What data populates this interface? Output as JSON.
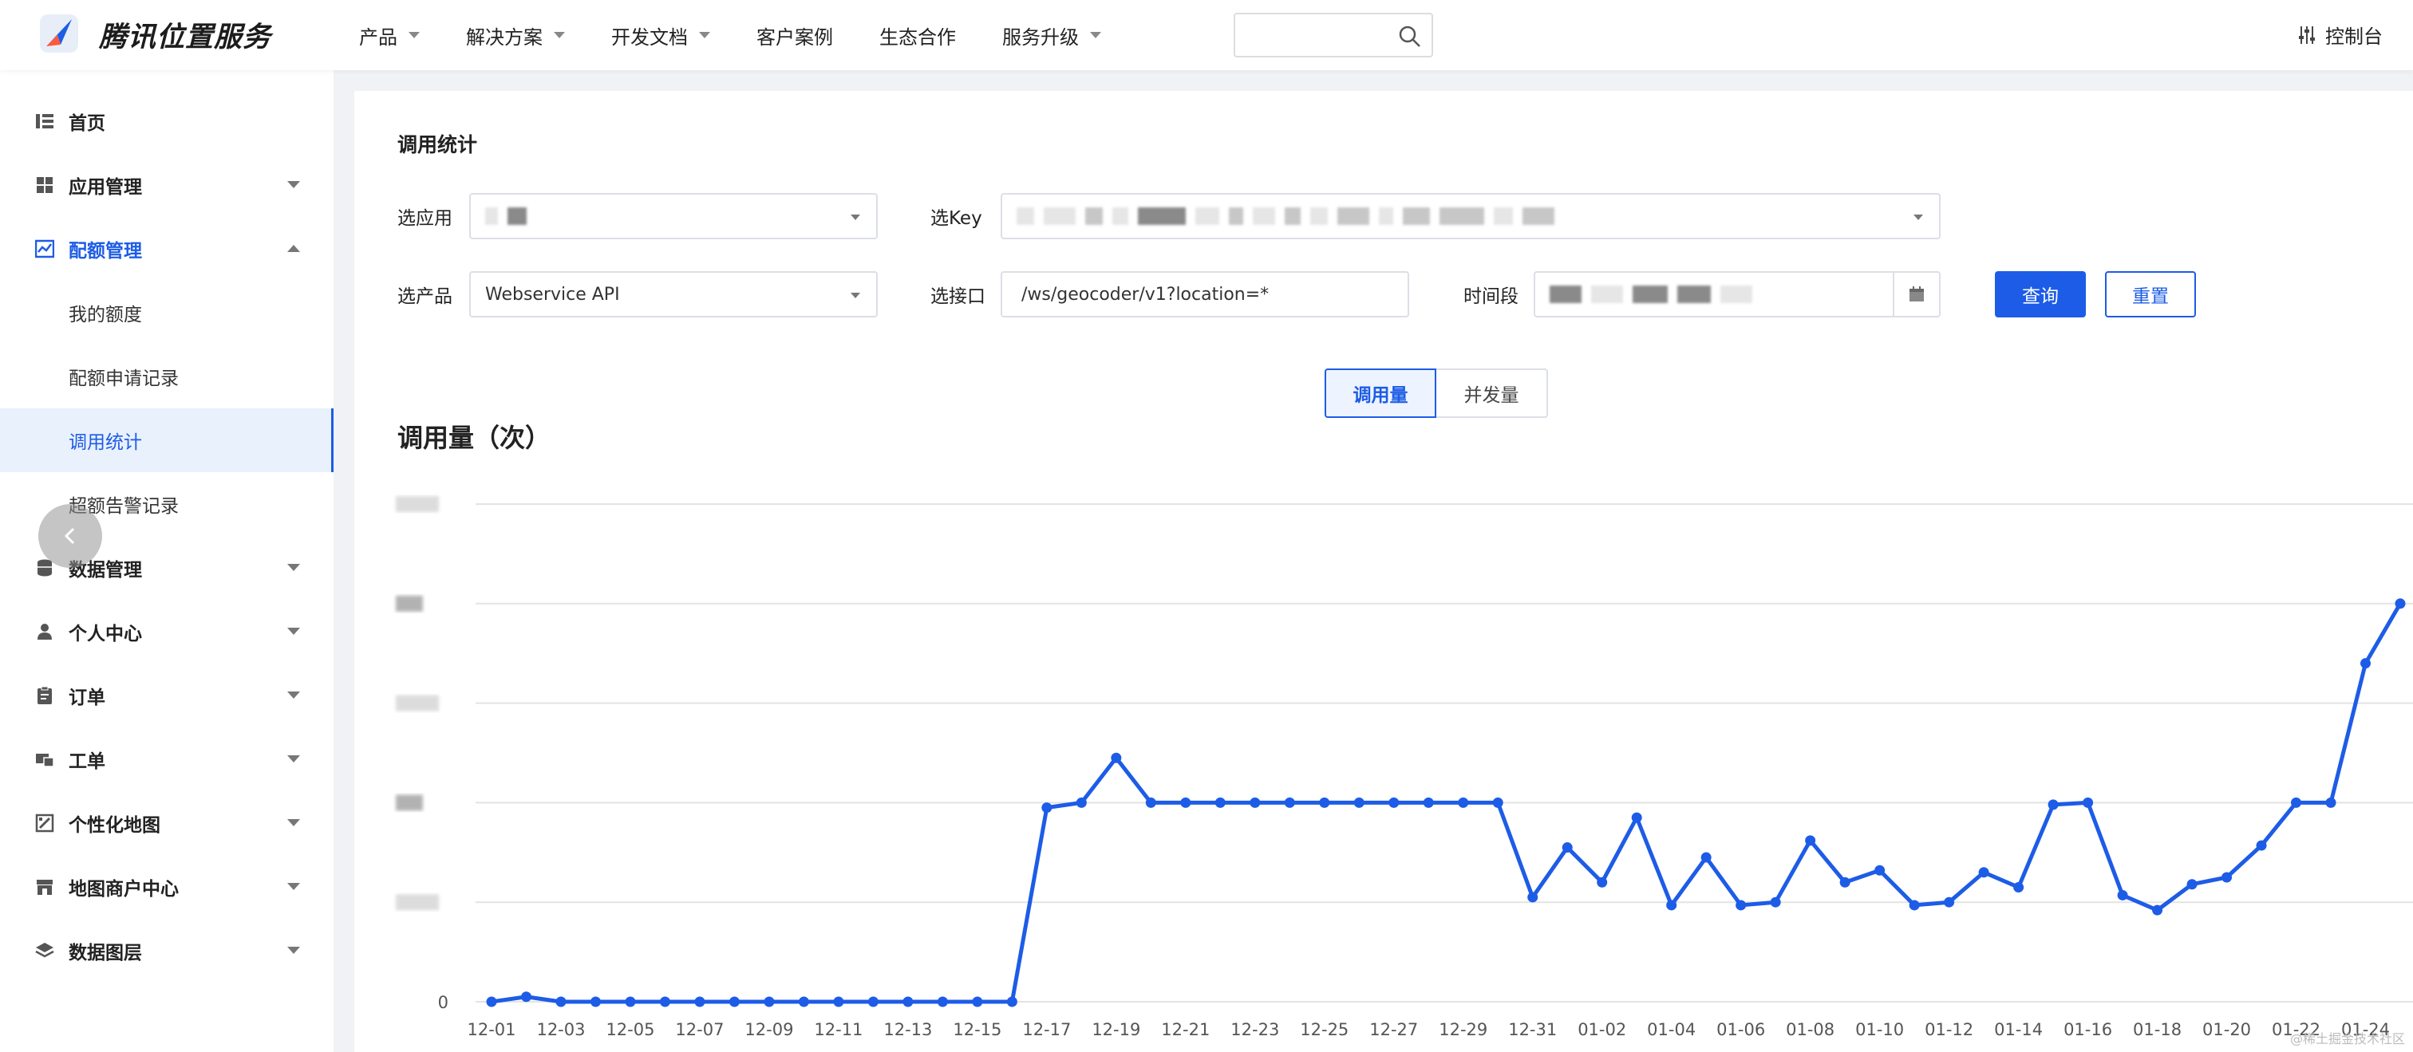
{
  "header": {
    "brand": "腾讯位置服务",
    "nav": [
      "产品",
      "解决方案",
      "开发文档",
      "客户案例",
      "生态合作",
      "服务升级"
    ],
    "nav_has_caret": [
      true,
      true,
      true,
      false,
      false,
      true
    ],
    "search_placeholder": "",
    "console": "控制台"
  },
  "sidebar": {
    "home": "首页",
    "app_manage": "应用管理",
    "quota_manage": "配额管理",
    "quota_sub": [
      "我的额度",
      "配额申请记录",
      "调用统计",
      "超额告警记录"
    ],
    "data_manage": "数据管理",
    "personal": "个人中心",
    "orders": "订单",
    "tickets": "工单",
    "custom_map": "个性化地图",
    "merchant": "地图商户中心",
    "data_layers": "数据图层"
  },
  "main": {
    "title": "调用统计",
    "label_app": "选应用",
    "label_key": "选Key",
    "label_product": "选产品",
    "product_value": "Webservice API",
    "label_api": "选接口",
    "api_value": "/ws/geocoder/v1?location=*",
    "label_time": "时间段",
    "btn_query": "查询",
    "btn_reset": "重置",
    "tab_calls": "调用量",
    "tab_concurrency": "并发量",
    "chart_title": "调用量（次）"
  },
  "watermark": "@稀土掘金技术社区",
  "chart_data": {
    "type": "line",
    "title": "调用量（次）",
    "xlabel": "",
    "ylabel": "",
    "y_tick_labels_visible": [
      "0"
    ],
    "y_levels": 5,
    "color": "#1d5ce6",
    "x_tick_labels": [
      "12-01",
      "12-03",
      "12-05",
      "12-07",
      "12-09",
      "12-11",
      "12-13",
      "12-15",
      "12-17",
      "12-19",
      "12-21",
      "12-23",
      "12-25",
      "12-27",
      "12-29",
      "12-31",
      "01-02",
      "01-04",
      "01-06",
      "01-08",
      "01-10",
      "01-12",
      "01-14",
      "01-16",
      "01-18",
      "01-20",
      "01-22",
      "01-24"
    ],
    "x": [
      "12-01",
      "12-02",
      "12-03",
      "12-04",
      "12-05",
      "12-06",
      "12-07",
      "12-08",
      "12-09",
      "12-10",
      "12-11",
      "12-12",
      "12-13",
      "12-14",
      "12-15",
      "12-16",
      "12-17",
      "12-18",
      "12-19",
      "12-20",
      "12-21",
      "12-22",
      "12-23",
      "12-24",
      "12-25",
      "12-26",
      "12-27",
      "12-28",
      "12-29",
      "12-30",
      "12-31",
      "01-01",
      "01-02",
      "01-03",
      "01-04",
      "01-05",
      "01-06",
      "01-07",
      "01-08",
      "01-09",
      "01-10",
      "01-11",
      "01-12",
      "01-13",
      "01-14",
      "01-15",
      "01-16",
      "01-17",
      "01-18",
      "01-19",
      "01-20",
      "01-21",
      "01-22",
      "01-23",
      "01-24",
      "01-25"
    ],
    "y": [
      0,
      0.05,
      0,
      0,
      0,
      0,
      0,
      0,
      0,
      0,
      0,
      0,
      0,
      0,
      0,
      0,
      1.95,
      2.0,
      2.45,
      2.0,
      2.0,
      2.0,
      2.0,
      2.0,
      2.0,
      2.0,
      2.0,
      2.0,
      2.0,
      2.0,
      1.05,
      1.55,
      1.2,
      1.85,
      0.97,
      1.45,
      0.97,
      1.0,
      1.62,
      1.2,
      1.32,
      0.97,
      1.0,
      1.3,
      1.15,
      1.98,
      2.0,
      1.07,
      0.92,
      1.18,
      1.25,
      1.57,
      2.0,
      2.0,
      3.4,
      4.0
    ],
    "ylim": [
      0,
      5
    ]
  }
}
